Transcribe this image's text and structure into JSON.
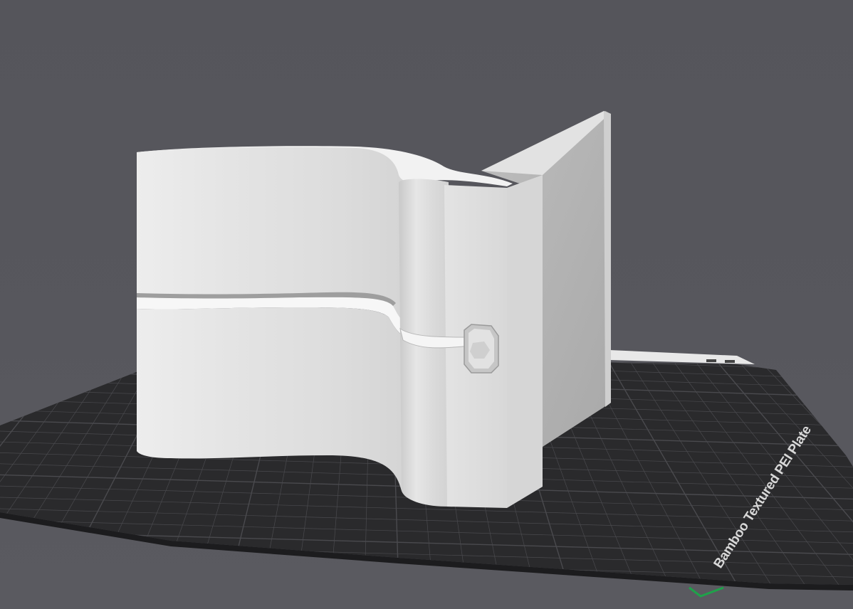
{
  "viewport": {
    "background_color": "#55555b"
  },
  "plate": {
    "name": "Bamboo Textured PEI Plate",
    "surface_color": "#2a2a2c",
    "grid_color": "#4a4a4e",
    "edge_color": "#1c1c1e"
  },
  "model": {
    "color": "#d7d7d7"
  },
  "axis_marker": {
    "color": "#1fa24a"
  }
}
